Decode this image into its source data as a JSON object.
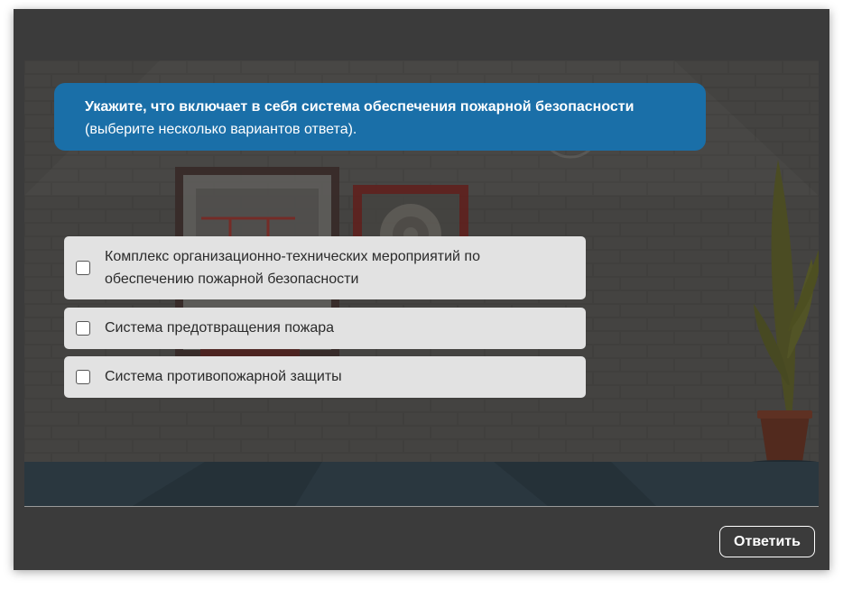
{
  "question": {
    "main": "Укажите, что включает в себя система обеспечения пожарной безопасности",
    "hint": "(выберите несколько вариантов ответа)."
  },
  "options": [
    {
      "label": "Комплекс организационно-технических мероприятий по обеспечению пожарной безопасности",
      "checked": false
    },
    {
      "label": "Система предотвращения пожара",
      "checked": false
    },
    {
      "label": "Система противопожарной защиты",
      "checked": false
    }
  ],
  "submit_label": "Ответить",
  "colors": {
    "question_bg": "#1a6fa8",
    "option_bg": "#e2e2e2",
    "frame_bg": "#3b3b3b"
  }
}
